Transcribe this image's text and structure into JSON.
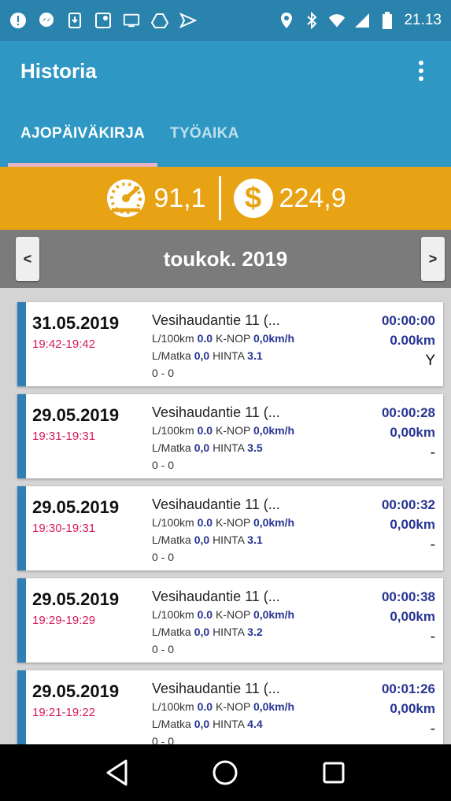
{
  "status_bar": {
    "time": "21.13",
    "icons": [
      "alert-icon",
      "messenger-icon",
      "download-icon",
      "maps-icon",
      "cast-icon",
      "drive-icon",
      "send-icon",
      "location-icon",
      "bluetooth-icon",
      "wifi-icon",
      "signal-icon",
      "battery-icon"
    ]
  },
  "app_bar": {
    "title": "Historia",
    "menu_icon": "more-vert-icon"
  },
  "tabs": [
    {
      "label": "AJOPÄIVÄKIRJA",
      "active": true
    },
    {
      "label": "TYÖAIKA",
      "active": false
    }
  ],
  "summary": {
    "distance_value": "91,1",
    "cost_value": "224,9",
    "distance_icon": "speedometer-icon",
    "cost_icon": "dollar-icon",
    "background_color": "#e8a314"
  },
  "month_nav": {
    "prev_label": "<",
    "next_label": ">",
    "month": "toukok. 2019"
  },
  "entries": [
    {
      "date": "31.05.2019",
      "time": "19:42-19:42",
      "address": "Vesihaudantie 11 (...",
      "l100_label": "L/100km",
      "l100": "0.0",
      "knop_label": "K-NOP",
      "knop": "0,0km/h",
      "lmatka_label": "L/Matka",
      "lmatka": "0,0",
      "hinta_label": "HINTA",
      "hinta": "3.1",
      "range": "0 - 0",
      "duration": "00:00:00",
      "distance": "0.00km",
      "flag": "Y"
    },
    {
      "date": "29.05.2019",
      "time": "19:31-19:31",
      "address": "Vesihaudantie 11 (...",
      "l100_label": "L/100km",
      "l100": "0.0",
      "knop_label": "K-NOP",
      "knop": "0,0km/h",
      "lmatka_label": "L/Matka",
      "lmatka": "0,0",
      "hinta_label": "HINTA",
      "hinta": "3.5",
      "range": "0 - 0",
      "duration": "00:00:28",
      "distance": "0,00km",
      "flag": "-"
    },
    {
      "date": "29.05.2019",
      "time": "19:30-19:31",
      "address": "Vesihaudantie 11 (...",
      "l100_label": "L/100km",
      "l100": "0.0",
      "knop_label": "K-NOP",
      "knop": "0,0km/h",
      "lmatka_label": "L/Matka",
      "lmatka": "0,0",
      "hinta_label": "HINTA",
      "hinta": "3.1",
      "range": "0 - 0",
      "duration": "00:00:32",
      "distance": "0,00km",
      "flag": "-"
    },
    {
      "date": "29.05.2019",
      "time": "19:29-19:29",
      "address": "Vesihaudantie 11 (...",
      "l100_label": "L/100km",
      "l100": "0.0",
      "knop_label": "K-NOP",
      "knop": "0,0km/h",
      "lmatka_label": "L/Matka",
      "lmatka": "0,0",
      "hinta_label": "HINTA",
      "hinta": "3.2",
      "range": "0 - 0",
      "duration": "00:00:38",
      "distance": "0,00km",
      "flag": "-"
    },
    {
      "date": "29.05.2019",
      "time": "19:21-19:22",
      "address": "Vesihaudantie 11 (...",
      "l100_label": "L/100km",
      "l100": "0.0",
      "knop_label": "K-NOP",
      "knop": "0,0km/h",
      "lmatka_label": "L/Matka",
      "lmatka": "0,0",
      "hinta_label": "HINTA",
      "hinta": "4.4",
      "range": "0 - 0",
      "duration": "00:01:26",
      "distance": "0,00km",
      "flag": "-"
    }
  ],
  "nav_bar": {
    "buttons": [
      "back-icon",
      "home-icon",
      "recents-icon"
    ]
  },
  "colors": {
    "primary": "#2e97c3",
    "accent_pink": "#d81b60",
    "value_blue": "#283593",
    "card_stripe": "#2e7fb5"
  }
}
